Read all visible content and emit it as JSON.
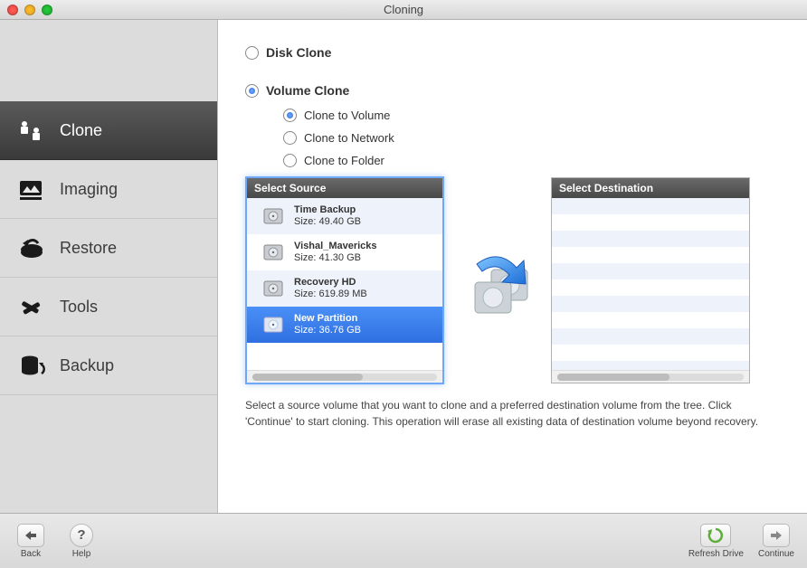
{
  "window": {
    "title": "Cloning"
  },
  "sidebar": {
    "items": [
      {
        "label": "Clone",
        "icon": "clone-icon",
        "active": true
      },
      {
        "label": "Imaging",
        "icon": "imaging-icon",
        "active": false
      },
      {
        "label": "Restore",
        "icon": "restore-icon",
        "active": false
      },
      {
        "label": "Tools",
        "icon": "tools-icon",
        "active": false
      },
      {
        "label": "Backup",
        "icon": "backup-icon",
        "active": false
      }
    ]
  },
  "main": {
    "disk_clone_label": "Disk Clone",
    "volume_clone_label": "Volume Clone",
    "clone_to_volume": "Clone to Volume",
    "clone_to_network": "Clone to Network",
    "clone_to_folder": "Clone to Folder",
    "selected_mode": "volume",
    "selected_sub": "volume",
    "source_header": "Select Source",
    "dest_header": "Select Destination",
    "drives": [
      {
        "name": "Time Backup",
        "size": "Size: 49.40 GB",
        "selected": false
      },
      {
        "name": "Vishal_Mavericks",
        "size": "Size: 41.30 GB",
        "selected": false
      },
      {
        "name": "Recovery HD",
        "size": "Size: 619.89 MB",
        "selected": false
      },
      {
        "name": "New Partition",
        "size": "Size: 36.76 GB",
        "selected": true
      }
    ],
    "hint": "Select a source volume that you want to clone and a preferred destination volume from the tree. Click 'Continue' to start cloning. This operation will erase all existing data of destination volume beyond recovery."
  },
  "toolbar": {
    "back": "Back",
    "help": "Help",
    "refresh": "Refresh Drive",
    "continue": "Continue"
  }
}
